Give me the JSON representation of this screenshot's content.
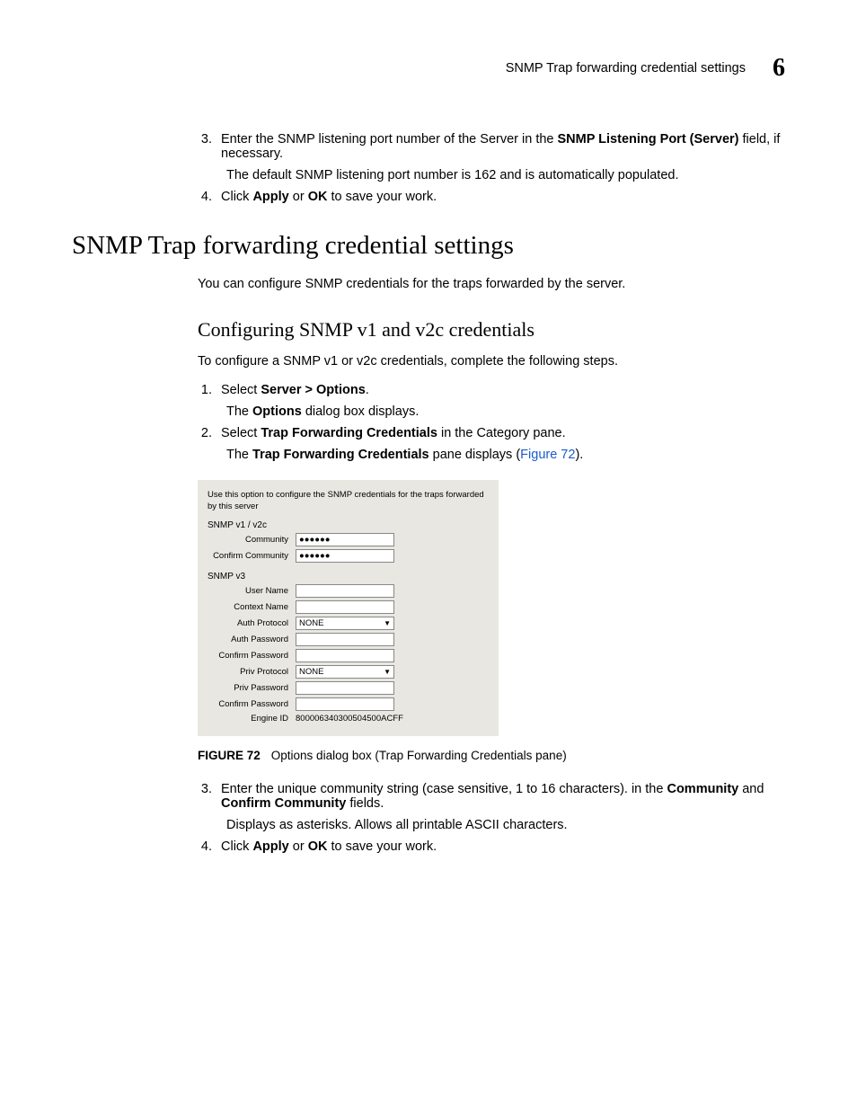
{
  "header": {
    "running_title": "SNMP Trap forwarding credential settings",
    "chapter_number": "6"
  },
  "intro_steps": {
    "start": 3,
    "items": [
      {
        "text_a": "Enter the SNMP listening port number of the Server in the ",
        "bold_a": "SNMP Listening Port (Server)",
        "text_b": " field, if necessary.",
        "sub": "The default SNMP listening port number is 162 and is automatically populated."
      },
      {
        "text_a": "Click ",
        "bold_a": "Apply",
        "text_b": " or ",
        "bold_b": "OK",
        "text_c": " to save your work."
      }
    ]
  },
  "h1": "SNMP Trap forwarding credential settings",
  "p1": "You can configure SNMP credentials for the traps forwarded by the server.",
  "h2": "Configuring SNMP v1 and v2c credentials",
  "p2": "To configure a SNMP v1 or v2c credentials, complete the following steps.",
  "config_steps": {
    "items": [
      {
        "text_a": "Select ",
        "bold_a": "Server > Options",
        "text_b": ".",
        "sub_a": "The ",
        "sub_bold": "Options",
        "sub_b": " dialog box displays."
      },
      {
        "text_a": "Select ",
        "bold_a": "Trap Forwarding Credentials",
        "text_b": " in the Category pane.",
        "sub_a": "The ",
        "sub_bold": "Trap Forwarding Credentials",
        "sub_b": " pane displays (",
        "sub_link": "Figure 72",
        "sub_c": ")."
      }
    ]
  },
  "dialog": {
    "description": "Use this option to configure the SNMP credentials for the traps forwarded by this server",
    "section1": "SNMP v1 / v2c",
    "community_label": "Community",
    "community_value": "●●●●●●",
    "confirm_community_label": "Confirm Community",
    "confirm_community_value": "●●●●●●",
    "section2": "SNMP v3",
    "username_label": "User Name",
    "contextname_label": "Context Name",
    "authproto_label": "Auth Protocol",
    "authproto_value": "NONE",
    "authpass_label": "Auth Password",
    "confauthpass_label": "Confirm Password",
    "privproto_label": "Priv Protocol",
    "privproto_value": "NONE",
    "privpass_label": "Priv Password",
    "confprivpass_label": "Confirm Password",
    "engineid_label": "Engine ID",
    "engineid_value": "800006340300504500ACFF"
  },
  "figure": {
    "label": "FIGURE 72",
    "caption": "Options dialog box (Trap Forwarding Credentials pane)"
  },
  "after_steps": {
    "start": 3,
    "items": [
      {
        "text_a": "Enter the unique community string (case sensitive, 1 to 16 characters). in the ",
        "bold_a": "Community",
        "text_b": " and ",
        "bold_b": "Confirm Community",
        "text_c": " fields.",
        "sub": "Displays as asterisks. Allows all printable ASCII characters."
      },
      {
        "text_a": "Click ",
        "bold_a": "Apply",
        "text_b": " or ",
        "bold_b": "OK",
        "text_c": " to save your work."
      }
    ]
  }
}
